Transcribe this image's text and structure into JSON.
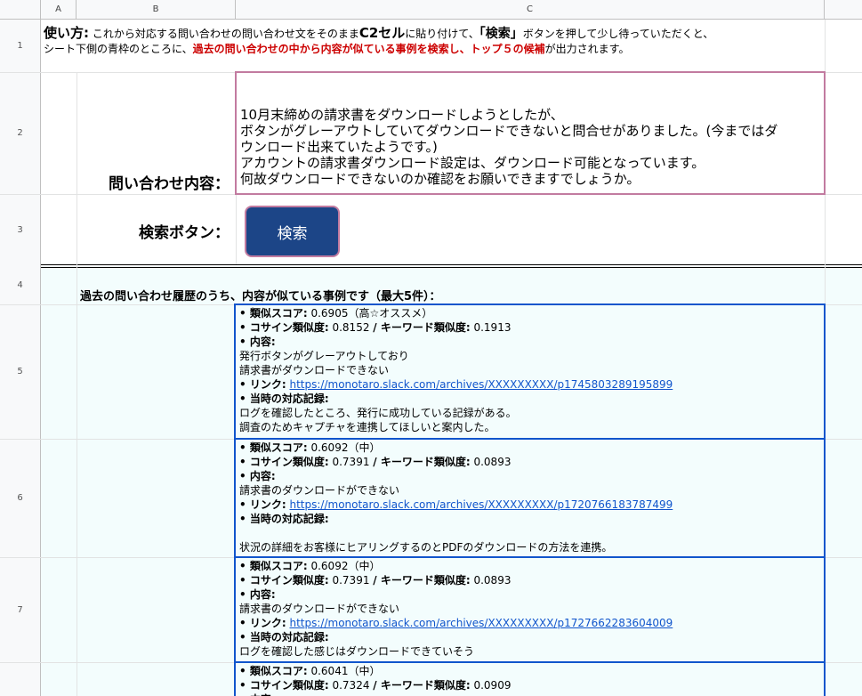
{
  "columns": [
    "A",
    "B",
    "C"
  ],
  "rows": [
    "1",
    "2",
    "3",
    "4",
    "5",
    "6",
    "7"
  ],
  "usage": {
    "label": "使い方",
    "colon": ":",
    "part1": " これから対応する問い合わせの問い合わせ文をそのまま",
    "cell_ref": "C2セル",
    "part2": "に貼り付けて、",
    "button_name": "「検索」",
    "part3": "ボタンを押して少し待っていただくと、",
    "line2_a": "シート下側の青枠のところに、",
    "line2_red": "過去の問い合わせの中から内容が似ている事例を検索し、トップ５の候補",
    "line2_b": "が出力されます。"
  },
  "inquiry": {
    "label": "問い合わせ内容：",
    "lines": [
      "10月末締めの請求書をダウンロードしようとしたが、",
      "ボタンがグレーアウトしていてダウンロードできないと問合せがありました。(今までは",
      "ダ",
      "ウンロード出来ていたようです。)",
      "アカウントの請求書ダウンロード設定は、ダウンロード可能となっています。",
      "何故ダウンロードできないのか確認をお願いできますでしょうか。"
    ]
  },
  "search": {
    "label": "検索ボタン：",
    "button": "検索"
  },
  "results_header": "過去の問い合わせ履歴のうち、内容が似ている事例です（最大5件）：",
  "labels": {
    "score": "• 類似スコア:",
    "sims_a": "• コサイン類似度:",
    "sims_b": "/ キーワード類似度:",
    "content": "• 内容:",
    "link": "• リンク:",
    "record": "• 当時の対応記録:"
  },
  "results": [
    {
      "score": " 0.6905（高☆オススメ）",
      "cos": " 0.8152 ",
      "kw": " 0.1913",
      "content": [
        "発行ボタンがグレーアウトしており",
        "請求書がダウンロードできない"
      ],
      "link": "https://monotaro.slack.com/archives/XXXXXXXXX/p1745803289195899",
      "record": [
        "ログを確認したところ、発行に成功している記録がある。",
        "調査のためキャプチャを連携してほしいと案内した。"
      ]
    },
    {
      "score": " 0.6092（中）",
      "cos": " 0.7391 ",
      "kw": " 0.0893",
      "content": [
        "請求書のダウンロードができない"
      ],
      "link": "https://monotaro.slack.com/archives/XXXXXXXXX/p1720766183787499",
      "record": [
        "",
        "状況の詳細をお客様にヒアリングするのとPDFのダウンロードの方法を連携。"
      ]
    },
    {
      "score": " 0.6092（中）",
      "cos": " 0.7391 ",
      "kw": " 0.0893",
      "content": [
        "請求書のダウンロードができない"
      ],
      "link": "https://monotaro.slack.com/archives/XXXXXXXXX/p1727662283604009",
      "record": [
        "ログを確認した感じはダウンロードできていそう"
      ]
    },
    {
      "score": " 0.6041（中）",
      "cos": " 0.7324 ",
      "kw": " 0.0909",
      "content": [],
      "link": "",
      "record": []
    }
  ]
}
